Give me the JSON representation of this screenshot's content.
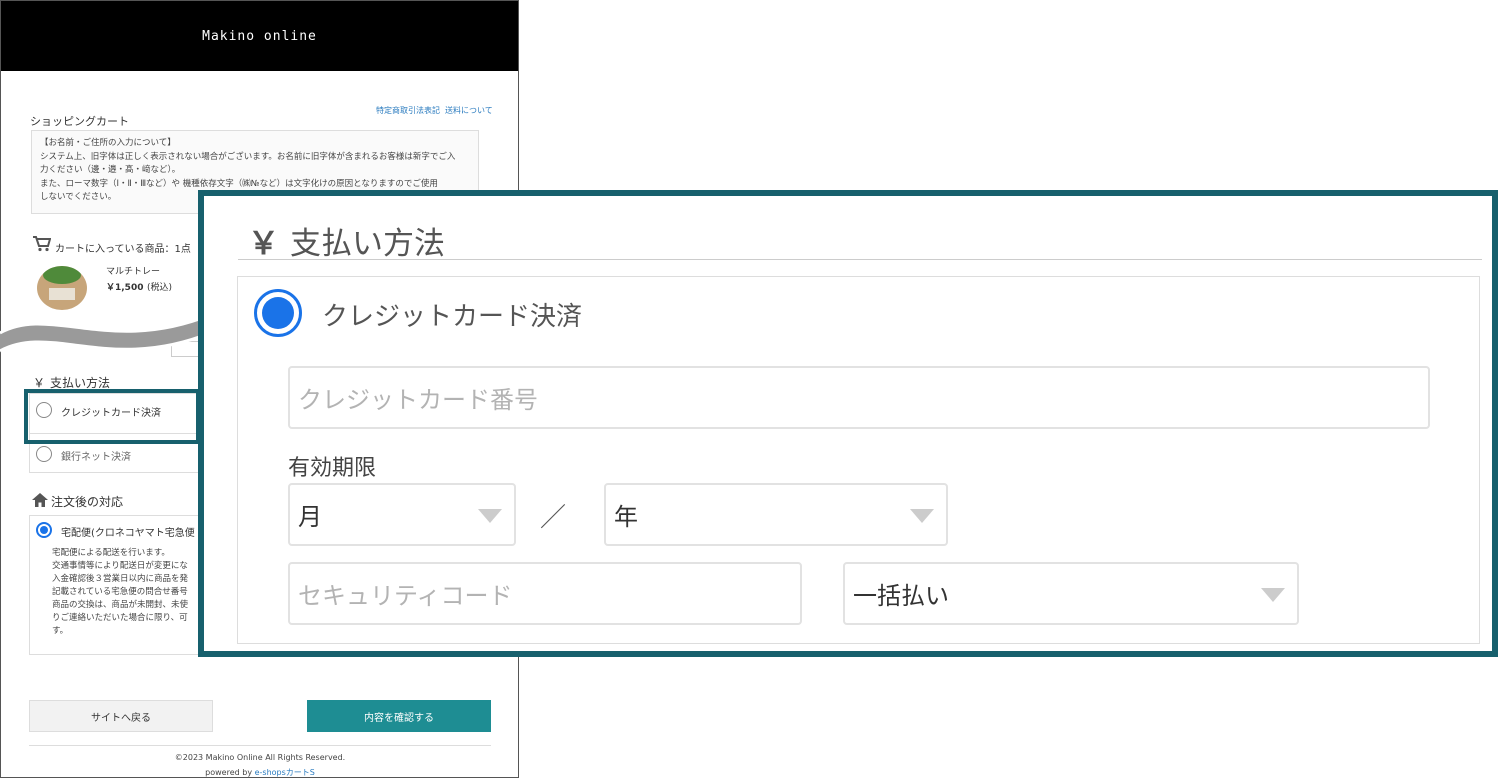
{
  "store": {
    "brand": "Makino online",
    "links": [
      "特定商取引法表記",
      "送料について"
    ],
    "cart_title": "ショッピングカート",
    "notice_lines": [
      "【お名前・ご住所の入力について】",
      "システム上、旧字体は正しく表示されない場合がございます。お名前に旧字体が含まれるお客様は新字でご入",
      "力ください（邊・邉・髙・﨑など）。",
      "また、ローマ数字（Ⅰ・Ⅱ・Ⅲなど）や 機種依存文字（㈱№など）は文字化けの原因となりますのでご使用",
      "しないでください。"
    ],
    "cart_count_label": "カートに入っている商品：1点",
    "product": {
      "name": "マルチトレー",
      "price": "￥1,500",
      "tax": "(税込)"
    },
    "payment": {
      "section_title": "支払い方法",
      "yen_symbol": "￥",
      "options": [
        "クレジットカード決済",
        "銀行ネット決済"
      ]
    },
    "shipping": {
      "section_title": "注文後の対応",
      "selected_option": "宅配便(クロネコヤマト宅急便",
      "description_lines": [
        "宅配便による配送を行います。",
        "交通事情等により配送日が変更にな",
        "入金確認後３営業日以内に商品を発",
        "記載されている宅急便の問合せ番号",
        "商品の交換は、商品が未開封、未使",
        "りご連絡いただいた場合に限り、可",
        "す。"
      ]
    },
    "buttons": {
      "back": "サイトへ戻る",
      "confirm": "内容を確認する"
    },
    "footer": {
      "copyright": "©2023 Makino Online All Rights Reserved.",
      "powered_prefix": "powered by ",
      "powered_link": "e-shopsカートS"
    }
  },
  "zoom": {
    "yen_symbol": "￥",
    "section_title": "支払い方法",
    "option_label": "クレジットカード決済",
    "card_number_placeholder": "クレジットカード番号",
    "expiry_label": "有効期限",
    "month_value": "月",
    "separator": "／",
    "year_value": "年",
    "security_code_placeholder": "セキュリティコード",
    "installment_value": "一括払い"
  },
  "colors": {
    "accent": "#17606d",
    "button_teal": "#1e8d93",
    "radio_blue": "#1a73e8"
  }
}
